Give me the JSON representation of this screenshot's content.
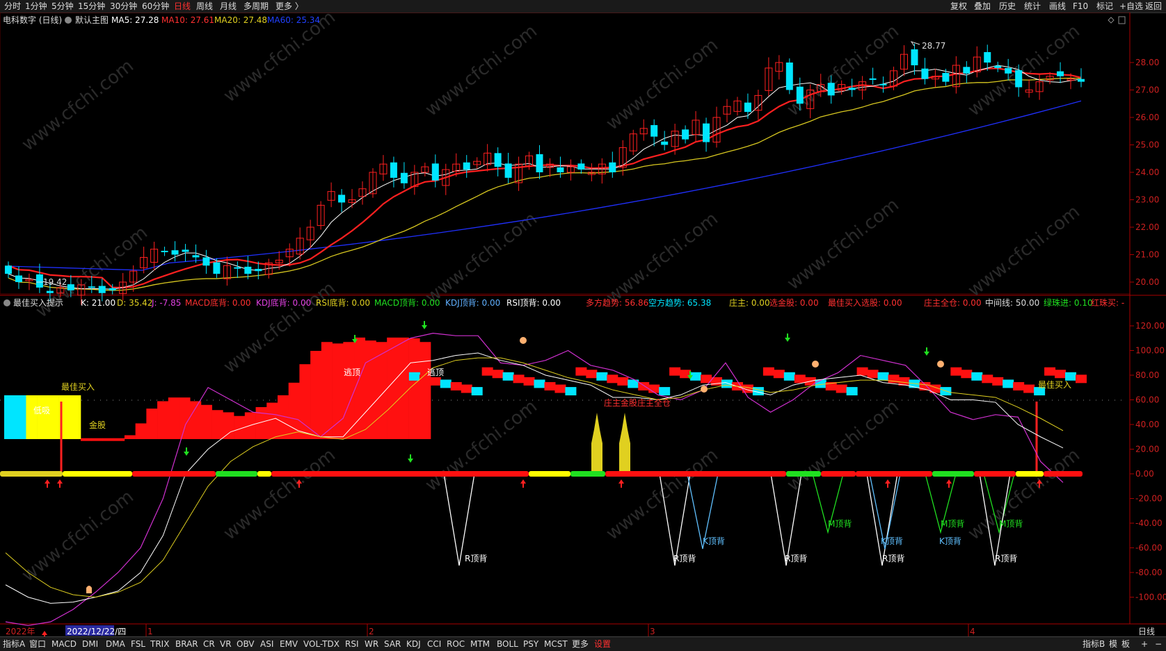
{
  "toolbar": {
    "periods": [
      "分时",
      "1分钟",
      "5分钟",
      "15分钟",
      "30分钟",
      "60分钟",
      "日线",
      "周线",
      "月线",
      "多周期",
      "更多 〉"
    ],
    "active_period": "日线",
    "right_tools": [
      "复权",
      "叠加",
      "历史",
      "统计",
      "画线",
      "F10",
      "标记",
      "+自选",
      "返回"
    ]
  },
  "main_panel": {
    "stock_label": "电科数字 (日线)",
    "template_label": "默认主图",
    "ma5": "MA5: 27.28",
    "ma10": "MA10: 27.61",
    "ma20": "MA20: 27.48",
    "ma60": "MA60: 25.34",
    "high_marker": "28.77",
    "low_marker": "19.42",
    "y_ticks": [
      "28.00",
      "27.00",
      "26.00",
      "25.00",
      "24.00",
      "23.00",
      "22.00",
      "21.00",
      "20.00"
    ]
  },
  "indicator_panel": {
    "name": "最佳买入提示",
    "k": "K: 21.00",
    "d": "D: 35.42",
    "j": "J: -7.85",
    "macd_bottom": "MACD底背: 0.00",
    "kdj_bottom": "KDJ底背: 0.00",
    "rsi_bottom": "RSI底背: 0.00",
    "macd_top": "MACD顶背: 0.00",
    "kdj_top": "KDJ顶背: 0.00",
    "rsi_top": "RSI顶背: 0.00",
    "long_trend": "多方趋势: 56.86",
    "short_trend": "空方趋势: 65.38",
    "banker": "庄主: 0.00",
    "gold_pick": "选金股: 0.00",
    "best_pick": "最佳买入选股: 0.00",
    "banker_full": "庄主全仓: 0.00",
    "midline": "中间线: 50.00",
    "green_in": "绿珠进: 0.10",
    "red_buy": "红珠买: -",
    "y_ticks": [
      "120.00",
      "100.00",
      "80.00",
      "60.00",
      "40.00",
      "20.00",
      "0.00",
      "-20.00",
      "-40.00",
      "-60.00",
      "-80.00",
      "-100.00"
    ],
    "annotations": {
      "best_buy_left": "最佳买入",
      "low_suck": "低吸",
      "gold_stock": "金股",
      "escape1": "逃顶",
      "escape2": "逃顶",
      "banker_label": "庄主金股庄主全仓",
      "best_buy_right": "最佳买入",
      "r_top_1": "R顶背",
      "r_top_2": "R顶背",
      "k_top_1": "K顶背",
      "r_top_3": "R顶背",
      "m_top_1": "M顶背",
      "k_top_2": "K顶背",
      "r_top_4": "R顶背",
      "m_top_2": "M顶背",
      "k_top_3": "K顶背",
      "m_top_3": "M顶背",
      "r_top_5": "R顶背"
    }
  },
  "xaxis": {
    "year_label": "2022年",
    "cursor_date": "2022/12/22/四",
    "months": [
      "1",
      "2",
      "3",
      "4"
    ],
    "period_label": "日线"
  },
  "bottom_tabs": {
    "left": [
      "指标A",
      "窗口",
      "MACD",
      "DMI",
      "DMA",
      "FSL",
      "TRIX",
      "BRAR",
      "CR",
      "VR",
      "OBV",
      "ASI",
      "EMV",
      "VOL-TDX",
      "RSI",
      "WR",
      "SAR",
      "KDJ",
      "CCI",
      "ROC",
      "MTM",
      "BOLL",
      "PSY",
      "MCST",
      "更多",
      "设置"
    ],
    "right": [
      "指标B",
      "模",
      "板",
      "+",
      "−"
    ]
  },
  "watermark": "www.cfchi.com",
  "colors": {
    "up": "#ff2020",
    "down": "#00e5ff",
    "ma5": "#ffffff",
    "ma10": "#ff2020",
    "ma20": "#e0d020",
    "ma60": "#2030ff",
    "axis": "#aa0000"
  }
}
